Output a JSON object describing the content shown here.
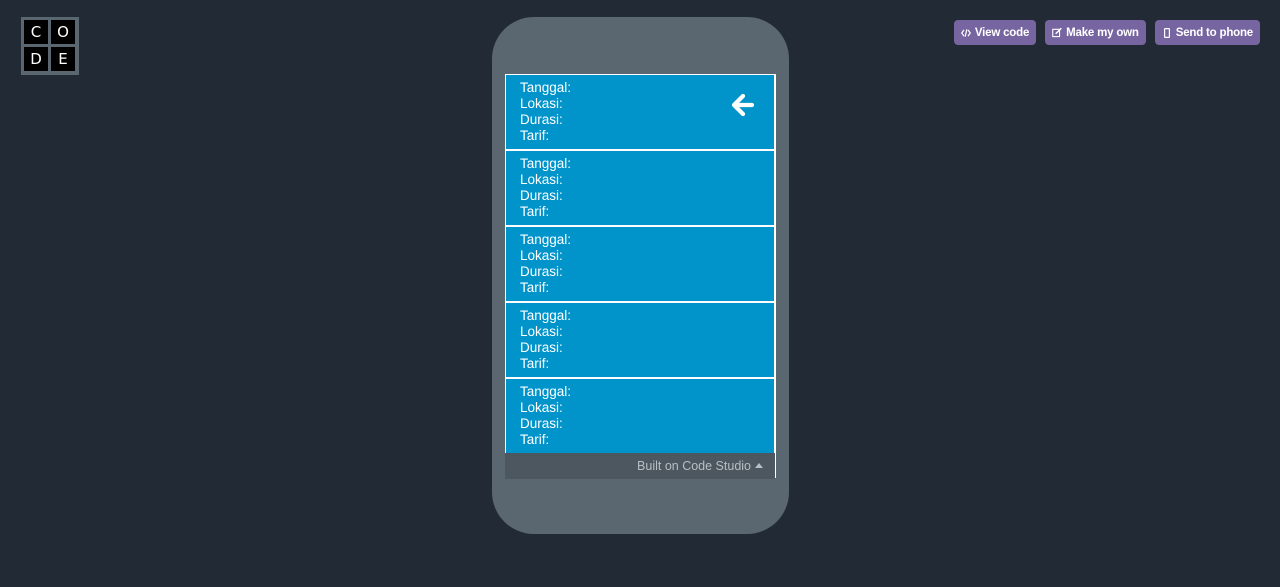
{
  "logo": {
    "letters": [
      "C",
      "O",
      "D",
      "E"
    ]
  },
  "actions": [
    {
      "label": "View code",
      "icon": "code-icon"
    },
    {
      "label": "Make my own",
      "icon": "edit-icon"
    },
    {
      "label": "Send to phone",
      "icon": "phone-icon"
    }
  ],
  "cards": [
    {
      "tanggal": "Tanggal:",
      "lokasi": "Lokasi:",
      "durasi": "Durasi:",
      "tarif": "Tarif:"
    },
    {
      "tanggal": "Tanggal:",
      "lokasi": "Lokasi:",
      "durasi": "Durasi:",
      "tarif": "Tarif:"
    },
    {
      "tanggal": "Tanggal:",
      "lokasi": "Lokasi:",
      "durasi": "Durasi:",
      "tarif": "Tarif:"
    },
    {
      "tanggal": "Tanggal:",
      "lokasi": "Lokasi:",
      "durasi": "Durasi:",
      "tarif": "Tarif:"
    },
    {
      "tanggal": "Tanggal:",
      "lokasi": "Lokasi:",
      "durasi": "Durasi:",
      "tarif": "Tarif:"
    }
  ],
  "footer": {
    "label": "Built on Code Studio"
  },
  "colors": {
    "background": "#222b35",
    "phone": "#5b6770",
    "card": "#0094ca",
    "button": "#7665a0"
  }
}
